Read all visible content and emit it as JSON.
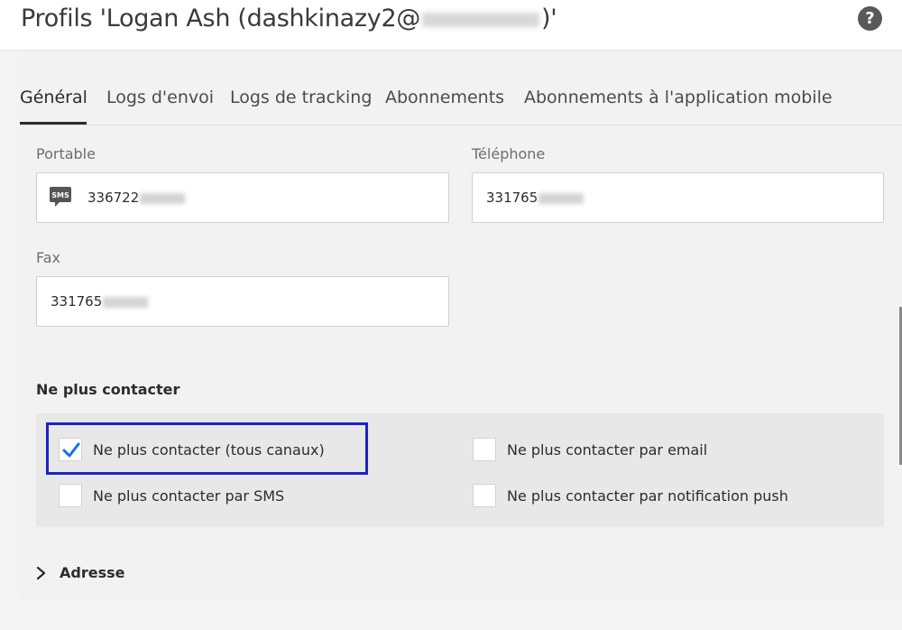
{
  "window": {
    "title_prefix": "Profils 'Logan Ash (dashkinazy2@",
    "title_suffix": ")'",
    "help_glyph": "?"
  },
  "tabs": [
    {
      "label": "Général"
    },
    {
      "label": "Logs d'envoi"
    },
    {
      "label": "Logs de tracking"
    },
    {
      "label": "Abonnements"
    },
    {
      "label": "Abonnements à l'application mobile"
    }
  ],
  "fields": {
    "portable": {
      "label": "Portable",
      "value": "336722"
    },
    "telephone": {
      "label": "Téléphone",
      "value": "331765"
    },
    "fax": {
      "label": "Fax",
      "value": "331765"
    }
  },
  "no_contact": {
    "title": "Ne plus contacter",
    "options": [
      {
        "label": "Ne plus contacter (tous canaux)",
        "checked": true
      },
      {
        "label": "Ne plus contacter par email",
        "checked": false
      },
      {
        "label": "Ne plus contacter par SMS",
        "checked": false
      },
      {
        "label": "Ne plus contacter par notification push",
        "checked": false
      }
    ]
  },
  "address_section": {
    "label": "Adresse"
  },
  "colors": {
    "highlight": "#1a23c9",
    "checkmark": "#1473e6"
  }
}
